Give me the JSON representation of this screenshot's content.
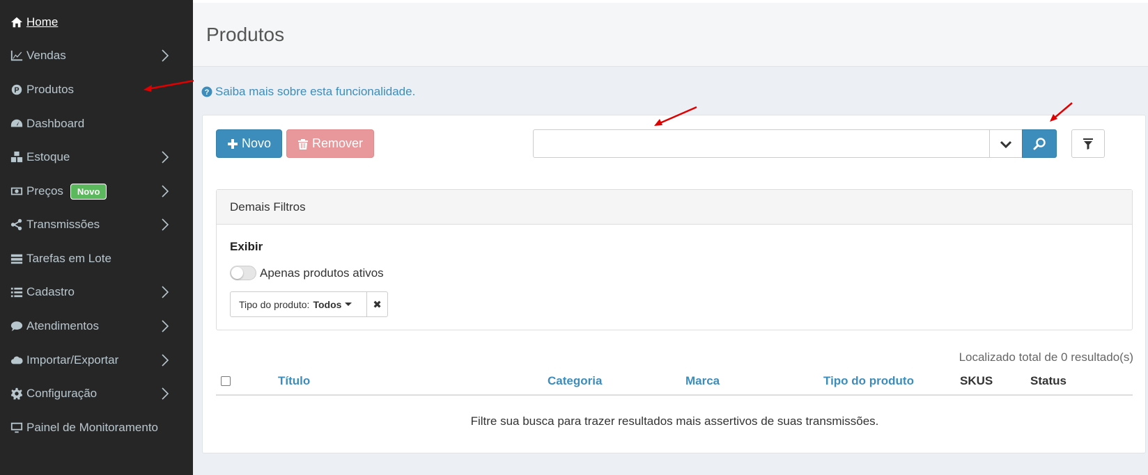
{
  "sidebar": {
    "items": [
      {
        "label": "Home",
        "icon": "home-icon"
      },
      {
        "label": "Vendas",
        "icon": "chart-line-icon"
      },
      {
        "label": "Produtos",
        "icon": "product-p-icon"
      },
      {
        "label": "Dashboard",
        "icon": "dashboard-icon"
      },
      {
        "label": "Estoque",
        "icon": "cubes-icon"
      },
      {
        "label": "Preços",
        "icon": "money-icon",
        "badge": "Novo"
      },
      {
        "label": "Transmissões",
        "icon": "share-icon"
      },
      {
        "label": "Tarefas em Lote",
        "icon": "tasks-icon"
      },
      {
        "label": "Cadastro",
        "icon": "list-icon"
      },
      {
        "label": "Atendimentos",
        "icon": "comment-icon"
      },
      {
        "label": "Importar/Exportar",
        "icon": "cloud-icon"
      },
      {
        "label": "Configuração",
        "icon": "gear-icon"
      },
      {
        "label": "Painel de Monitoramento",
        "icon": "monitor-icon"
      }
    ]
  },
  "header": {
    "title": "Produtos"
  },
  "help": {
    "text": "Saiba mais sobre esta funcionalidade."
  },
  "toolbar": {
    "new_label": "Novo",
    "remove_label": "Remover",
    "search_value": "",
    "search_placeholder": ""
  },
  "filters": {
    "title": "Demais Filtros",
    "section": "Exibir",
    "toggle_label": "Apenas produtos ativos",
    "type_label": "Tipo do produto:",
    "type_value": "Todos"
  },
  "results": {
    "total": "Localizado total de 0 resultado(s)",
    "columns": [
      "Título",
      "Categoria",
      "Marca",
      "Tipo do produto",
      "SKUS",
      "Status"
    ],
    "empty": "Filtre sua busca para trazer resultados mais assertivos de suas transmissões."
  },
  "colors": {
    "primary": "#3c8dbc",
    "sidebar": "#262626",
    "danger_light": "#e8989a",
    "success": "#5cb85c",
    "annotation": "#e00000"
  }
}
